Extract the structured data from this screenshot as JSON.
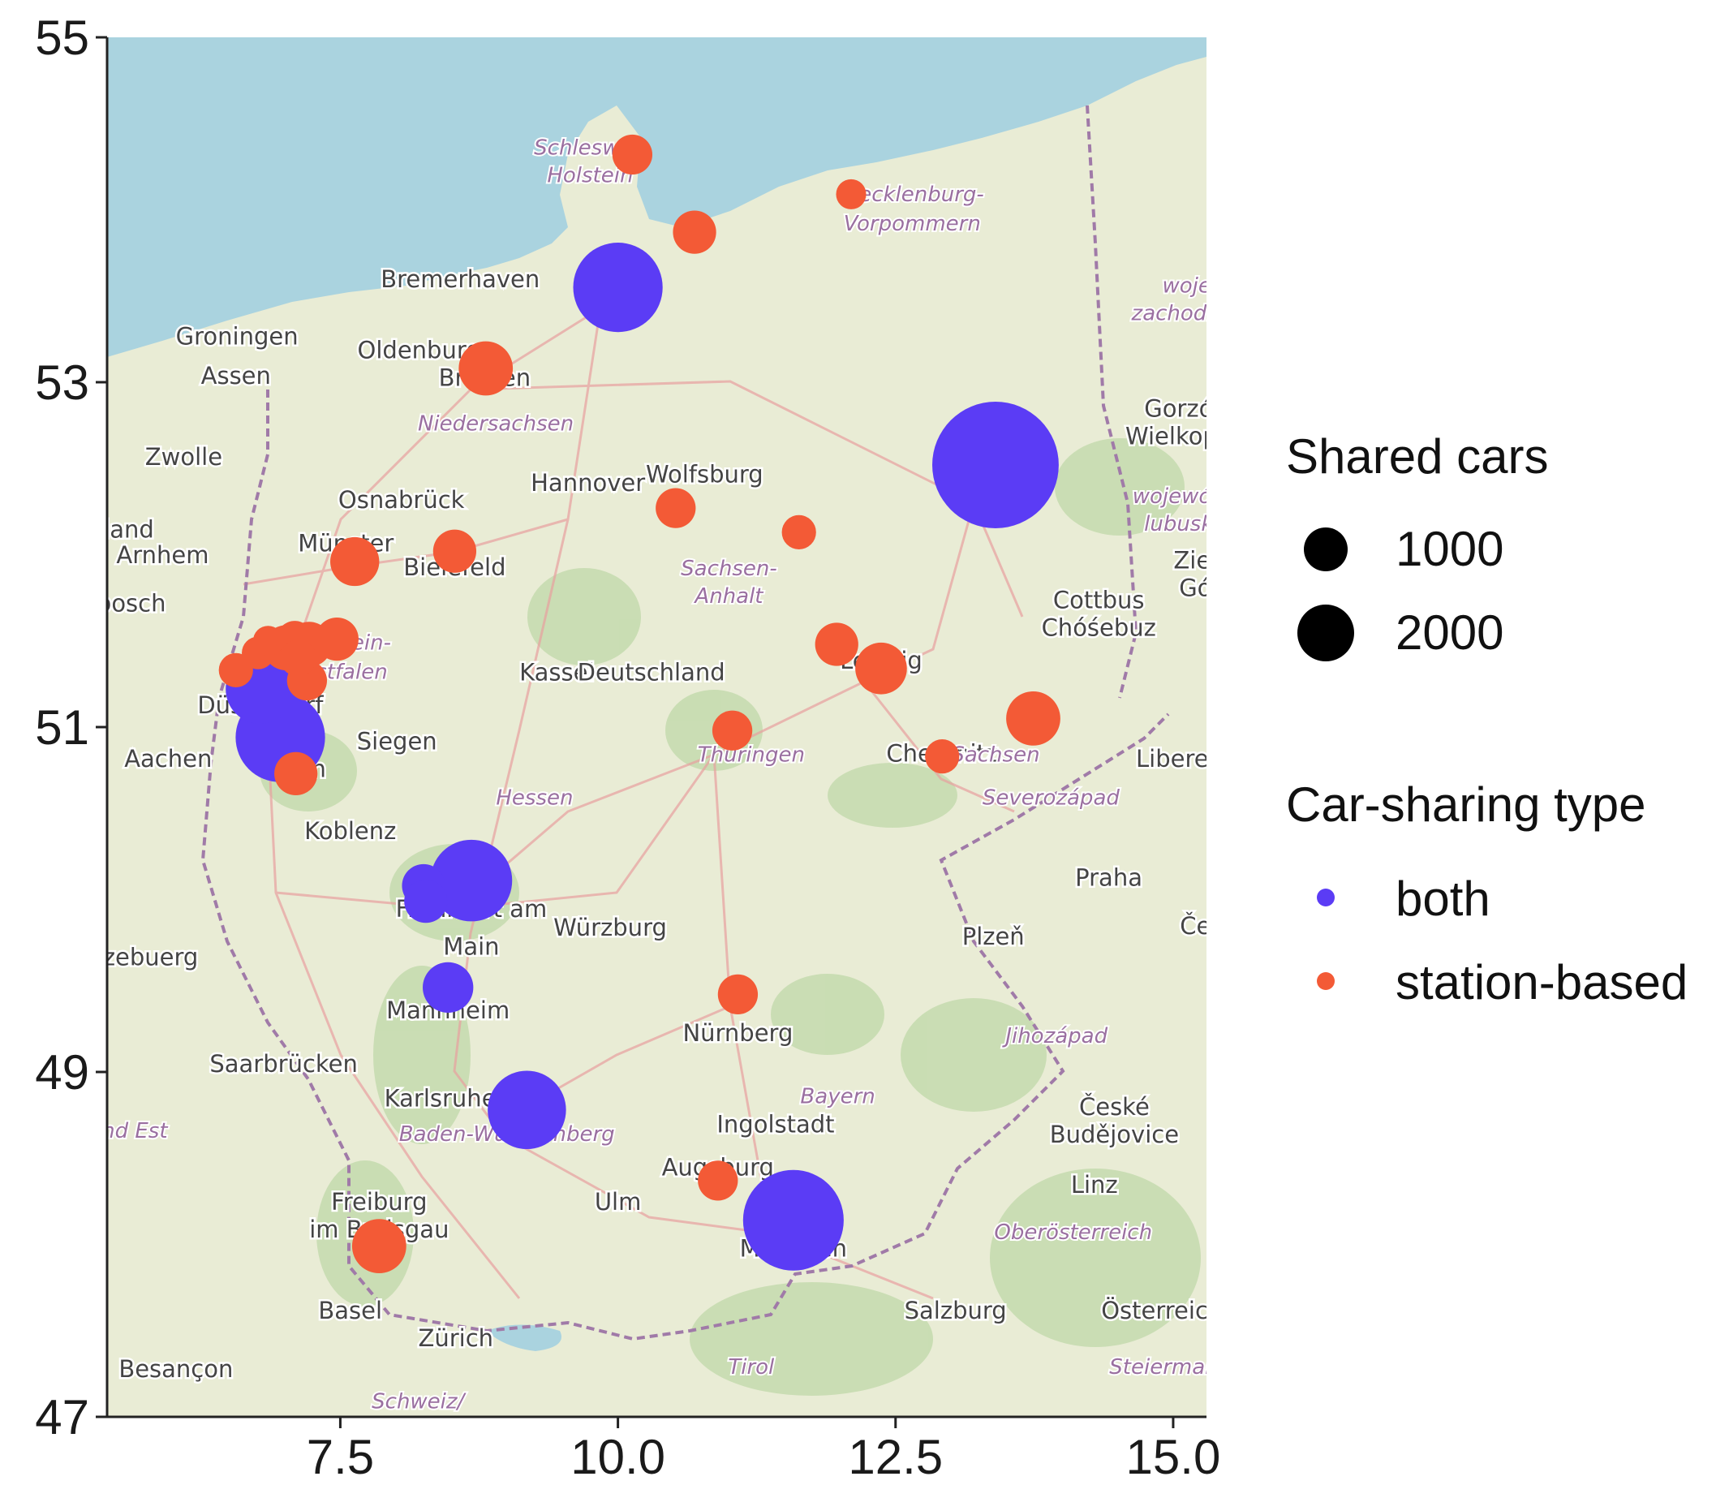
{
  "chart_data": {
    "type": "scatter",
    "title": "",
    "xlabel": "",
    "ylabel": "",
    "xlim": [
      5.4,
      15.3
    ],
    "ylim": [
      47,
      55
    ],
    "x_ticks": [
      7.5,
      10.0,
      12.5,
      15.0
    ],
    "x_tick_labels": [
      "7.5",
      "10.0",
      "12.5",
      "15.0"
    ],
    "y_ticks": [
      47,
      49,
      51,
      53,
      55
    ],
    "y_tick_labels": [
      "47",
      "49",
      "51",
      "53",
      "55"
    ],
    "grid": false,
    "background": "OpenStreetMap basemap of Germany",
    "size_legend": {
      "title": "Shared cars",
      "entries": [
        {
          "label": "1000",
          "value": 1000
        },
        {
          "label": "2000",
          "value": 2000
        }
      ]
    },
    "color_legend": {
      "title": "Car-sharing type",
      "entries": [
        {
          "label": "both",
          "color": "#5b3cf5"
        },
        {
          "label": "station-based",
          "color": "#f35a36"
        }
      ]
    },
    "legend_position": "right",
    "series": [
      {
        "name": "both",
        "color": "#5b3cf5",
        "points": [
          {
            "x": 13.4,
            "y": 52.52,
            "size": 3000
          },
          {
            "x": 10.0,
            "y": 53.55,
            "size": 1500
          },
          {
            "x": 11.58,
            "y": 48.14,
            "size": 1900
          },
          {
            "x": 6.96,
            "y": 50.94,
            "size": 1500
          },
          {
            "x": 6.78,
            "y": 51.22,
            "size": 900
          },
          {
            "x": 8.68,
            "y": 50.11,
            "size": 1250
          },
          {
            "x": 8.25,
            "y": 50.08,
            "size": 350
          },
          {
            "x": 8.27,
            "y": 49.99,
            "size": 350
          },
          {
            "x": 8.47,
            "y": 49.49,
            "size": 480
          },
          {
            "x": 9.18,
            "y": 48.78,
            "size": 1150
          }
        ]
      },
      {
        "name": "station-based",
        "color": "#f35a36",
        "points": [
          {
            "x": 10.13,
            "y": 54.32,
            "size": 300
          },
          {
            "x": 12.1,
            "y": 54.09,
            "size": 170
          },
          {
            "x": 10.69,
            "y": 53.87,
            "size": 350
          },
          {
            "x": 8.81,
            "y": 53.08,
            "size": 550
          },
          {
            "x": 7.63,
            "y": 51.96,
            "size": 450
          },
          {
            "x": 8.53,
            "y": 52.02,
            "size": 350
          },
          {
            "x": 10.52,
            "y": 52.27,
            "size": 300
          },
          {
            "x": 11.63,
            "y": 52.13,
            "size": 220
          },
          {
            "x": 12.37,
            "y": 51.34,
            "size": 500
          },
          {
            "x": 11.97,
            "y": 51.48,
            "size": 350
          },
          {
            "x": 13.74,
            "y": 51.05,
            "size": 550
          },
          {
            "x": 11.03,
            "y": 50.98,
            "size": 300
          },
          {
            "x": 12.92,
            "y": 50.83,
            "size": 220
          },
          {
            "x": 7.1,
            "y": 50.73,
            "size": 350
          },
          {
            "x": 11.08,
            "y": 49.45,
            "size": 300
          },
          {
            "x": 10.9,
            "y": 48.37,
            "size": 300
          },
          {
            "x": 7.85,
            "y": 47.99,
            "size": 550
          },
          {
            "x": 6.56,
            "y": 51.33,
            "size": 220
          },
          {
            "x": 6.76,
            "y": 51.43,
            "size": 200
          },
          {
            "x": 6.85,
            "y": 51.5,
            "size": 170
          },
          {
            "x": 7.01,
            "y": 51.46,
            "size": 380
          },
          {
            "x": 7.09,
            "y": 51.51,
            "size": 250
          },
          {
            "x": 7.12,
            "y": 51.4,
            "size": 250
          },
          {
            "x": 7.2,
            "y": 51.27,
            "size": 300
          },
          {
            "x": 7.22,
            "y": 51.48,
            "size": 380
          },
          {
            "x": 7.47,
            "y": 51.51,
            "size": 350
          }
        ]
      }
    ]
  },
  "map": {
    "colors": {
      "sea": "#aad3df",
      "land": "#e9ecd5",
      "forest": "#bfd8a8",
      "border": "#a07aa8",
      "road": "#e8a0a0"
    },
    "city_labels": [
      {
        "text": "Groningen",
        "x": 6.57,
        "y": 53.22
      },
      {
        "text": "Bremerhaven",
        "x": 8.58,
        "y": 53.55
      },
      {
        "text": "Oldenburg",
        "x": 8.21,
        "y": 53.14
      },
      {
        "text": "Assen",
        "x": 6.56,
        "y": 52.99
      },
      {
        "text": "Bremen",
        "x": 8.8,
        "y": 52.98
      },
      {
        "text": "Zwolle",
        "x": 6.09,
        "y": 52.52
      },
      {
        "text": "Osnabrück",
        "x": 8.05,
        "y": 52.27
      },
      {
        "text": "rland",
        "x": 5.55,
        "y": 52.1
      },
      {
        "text": "Hannover",
        "x": 9.73,
        "y": 52.37
      },
      {
        "text": "Wolfsburg",
        "x": 10.78,
        "y": 52.42
      },
      {
        "text": "Münster",
        "x": 7.55,
        "y": 52.02
      },
      {
        "text": "Bielefeld",
        "x": 8.53,
        "y": 51.88
      },
      {
        "text": "Arnhem",
        "x": 5.9,
        "y": 51.95
      },
      {
        "text": "hbosch",
        "x": 5.55,
        "y": 51.67
      },
      {
        "text": "Kassel",
        "x": 9.45,
        "y": 51.27
      },
      {
        "text": "Deutschland",
        "x": 10.3,
        "y": 51.27
      },
      {
        "text": "Leipzig",
        "x": 12.37,
        "y": 51.34
      },
      {
        "text": "Cottbus",
        "x": 14.33,
        "y": 51.69
      },
      {
        "text": "Chóśebuz",
        "x": 14.33,
        "y": 51.53
      },
      {
        "text": "Düsseldorf",
        "x": 6.78,
        "y": 51.08
      },
      {
        "text": "Aachen",
        "x": 5.95,
        "y": 50.77
      },
      {
        "text": "Bonn",
        "x": 7.1,
        "y": 50.71
      },
      {
        "text": "Siegen",
        "x": 8.01,
        "y": 50.87
      },
      {
        "text": "Koblenz",
        "x": 7.59,
        "y": 50.35
      },
      {
        "text": "Chemnitz",
        "x": 12.92,
        "y": 50.8
      },
      {
        "text": "Liberec",
        "x": 15.05,
        "y": 50.77
      },
      {
        "text": "Praha",
        "x": 14.42,
        "y": 50.08
      },
      {
        "text": "Frankfurt am",
        "x": 8.68,
        "y": 49.9
      },
      {
        "text": "Main",
        "x": 8.68,
        "y": 49.68
      },
      {
        "text": "Würzburg",
        "x": 9.93,
        "y": 49.79
      },
      {
        "text": "tzebuerg",
        "x": 5.75,
        "y": 49.62
      },
      {
        "text": "Plzeň",
        "x": 13.38,
        "y": 49.74
      },
      {
        "text": "Mannheim",
        "x": 8.47,
        "y": 49.31
      },
      {
        "text": "Nürnberg",
        "x": 11.08,
        "y": 49.18
      },
      {
        "text": "Saarbrücken",
        "x": 6.99,
        "y": 49.0
      },
      {
        "text": "Karlsruhe",
        "x": 8.4,
        "y": 48.8
      },
      {
        "text": "Ingolstadt",
        "x": 11.42,
        "y": 48.65
      },
      {
        "text": "České",
        "x": 14.47,
        "y": 48.75
      },
      {
        "text": "Budějovice",
        "x": 14.47,
        "y": 48.59
      },
      {
        "text": "Augsburg",
        "x": 10.9,
        "y": 48.4
      },
      {
        "text": "Linz",
        "x": 14.29,
        "y": 48.3
      },
      {
        "text": "Freiburg",
        "x": 7.85,
        "y": 48.2
      },
      {
        "text": "im Breisgau",
        "x": 7.85,
        "y": 48.04
      },
      {
        "text": "Ulm",
        "x": 10.0,
        "y": 48.2
      },
      {
        "text": "München",
        "x": 11.58,
        "y": 47.93
      },
      {
        "text": "Basel",
        "x": 7.59,
        "y": 47.57
      },
      {
        "text": "Salzburg",
        "x": 13.04,
        "y": 47.57
      },
      {
        "text": "Österreich",
        "x": 14.9,
        "y": 47.57
      },
      {
        "text": "Zürich",
        "x": 8.54,
        "y": 47.41
      },
      {
        "text": "Besançon",
        "x": 6.02,
        "y": 47.23
      },
      {
        "text": "Gorzó",
        "x": 15.05,
        "y": 52.8
      },
      {
        "text": "Wielkopo",
        "x": 15.05,
        "y": 52.64
      },
      {
        "text": "Ziel",
        "x": 15.2,
        "y": 51.92
      },
      {
        "text": "Gó",
        "x": 15.2,
        "y": 51.76
      },
      {
        "text": "Če",
        "x": 15.2,
        "y": 49.8
      }
    ],
    "region_labels": [
      {
        "text": "Schleswig-",
        "x": 9.75,
        "y": 54.32
      },
      {
        "text": "Holstein",
        "x": 9.75,
        "y": 54.16
      },
      {
        "text": "Mecklenburg-",
        "x": 12.65,
        "y": 54.05
      },
      {
        "text": "Vorpommern",
        "x": 12.65,
        "y": 53.88
      },
      {
        "text": "Niedersachsen",
        "x": 8.9,
        "y": 52.72
      },
      {
        "text": "Sachsen-",
        "x": 11.0,
        "y": 51.88
      },
      {
        "text": "Anhalt",
        "x": 11.0,
        "y": 51.72
      },
      {
        "text": "Nordrhein-",
        "x": 7.45,
        "y": 51.45
      },
      {
        "text": "Westfalen",
        "x": 7.45,
        "y": 51.28
      },
      {
        "text": "Thüringen",
        "x": 11.2,
        "y": 50.8
      },
      {
        "text": "Sachsen",
        "x": 13.4,
        "y": 50.8
      },
      {
        "text": "Hessen",
        "x": 9.25,
        "y": 50.55
      },
      {
        "text": "Severozápad",
        "x": 13.9,
        "y": 50.55
      },
      {
        "text": "Jihozápad",
        "x": 13.95,
        "y": 49.17
      },
      {
        "text": "Bayern",
        "x": 11.98,
        "y": 48.82
      },
      {
        "text": "Baden-Württemberg",
        "x": 9.0,
        "y": 48.6
      },
      {
        "text": "rand Est",
        "x": 5.55,
        "y": 48.62
      },
      {
        "text": "Oberösterreich",
        "x": 14.1,
        "y": 48.03
      },
      {
        "text": "Tirol",
        "x": 11.2,
        "y": 47.25
      },
      {
        "text": "Steiermark",
        "x": 14.95,
        "y": 47.25
      },
      {
        "text": "wojew",
        "x": 15.2,
        "y": 53.52
      },
      {
        "text": "zachodni",
        "x": 15.05,
        "y": 53.36
      },
      {
        "text": "wojewód",
        "x": 15.05,
        "y": 52.3
      },
      {
        "text": "lubusk",
        "x": 15.05,
        "y": 52.14
      },
      {
        "text": "Schweiz/",
        "x": 8.2,
        "y": 47.05
      }
    ]
  }
}
